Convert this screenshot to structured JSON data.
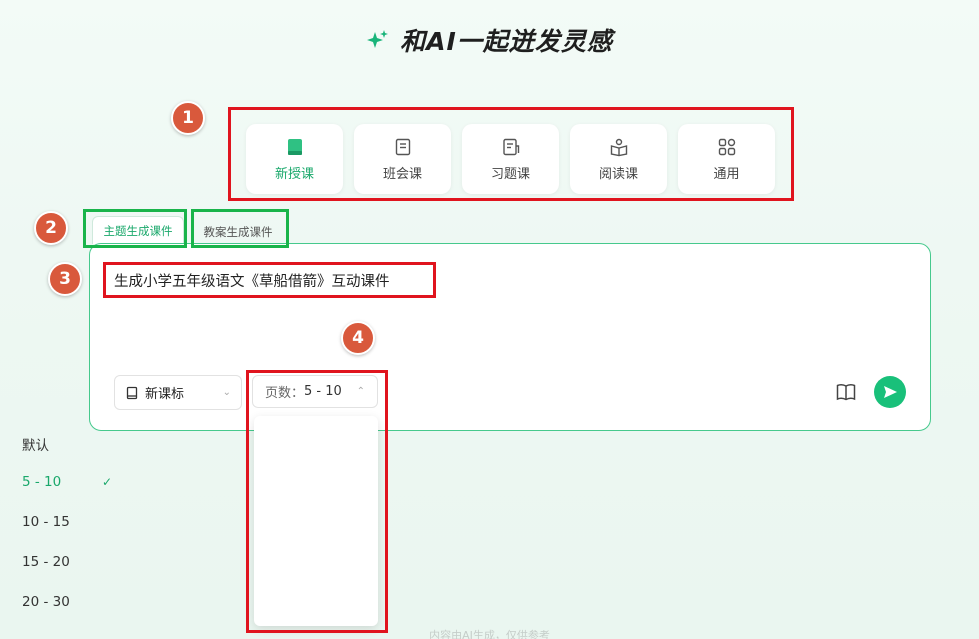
{
  "header": {
    "title": "和AI一起迸发灵感"
  },
  "badges": [
    "1",
    "2",
    "3",
    "4"
  ],
  "course_types": [
    {
      "label": "新授课",
      "icon": "book-icon",
      "active": true
    },
    {
      "label": "班会课",
      "icon": "document-icon",
      "active": false
    },
    {
      "label": "习题课",
      "icon": "exercise-icon",
      "active": false
    },
    {
      "label": "阅读课",
      "icon": "reading-icon",
      "active": false
    },
    {
      "label": "通用",
      "icon": "grid-icon",
      "active": false
    }
  ],
  "tabs": [
    {
      "label": "主题生成课件",
      "active": true
    },
    {
      "label": "教案生成课件",
      "active": false
    }
  ],
  "input": {
    "prompt": "生成小学五年级语文《草船借箭》互动课件"
  },
  "curriculum_select": {
    "value": "新课标"
  },
  "page_select": {
    "prefix": "页数：",
    "value": "5 - 10"
  },
  "page_options": [
    {
      "label": "默认",
      "selected": false
    },
    {
      "label": "5 - 10",
      "selected": true
    },
    {
      "label": "10 - 15",
      "selected": false
    },
    {
      "label": "15 - 20",
      "selected": false
    },
    {
      "label": "20 - 30",
      "selected": false
    }
  ],
  "footer": {
    "text": "内容由AI生成，仅供参考"
  },
  "colors": {
    "accent": "#19c07a",
    "annotation_red": "#e0141e",
    "annotation_green": "#19b44a",
    "badge": "#d9593c"
  }
}
